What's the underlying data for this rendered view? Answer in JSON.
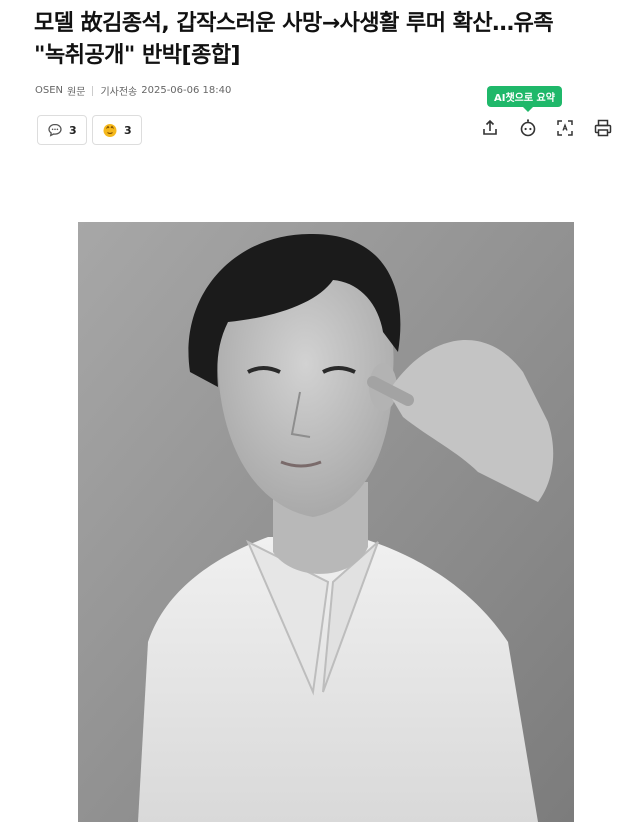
{
  "article": {
    "title_line1": "모델 故김종석, 갑작스러운 사망→사생활 루머 확산…유족",
    "title_line2": "\"녹취공개\" 반박[종합]"
  },
  "meta": {
    "source": "OSEN",
    "source_type": "원문",
    "sent_label": "기사전송",
    "timestamp": "2025-06-06 18:40"
  },
  "ai_summary": {
    "label": "AI챗으로 요약"
  },
  "reactions": {
    "comments": {
      "icon": "comment-icon",
      "count": "3"
    },
    "likes": {
      "icon": "reaction-emoji-icon",
      "count": "3"
    }
  },
  "toolbar": {
    "icons": [
      "share-icon",
      "ai-bot-icon",
      "text-size-icon",
      "print-icon"
    ]
  },
  "colors": {
    "accent_green": "#1fb86a",
    "title": "#111111",
    "meta": "#666666"
  },
  "image": {
    "type": "black-and-white portrait photo"
  }
}
